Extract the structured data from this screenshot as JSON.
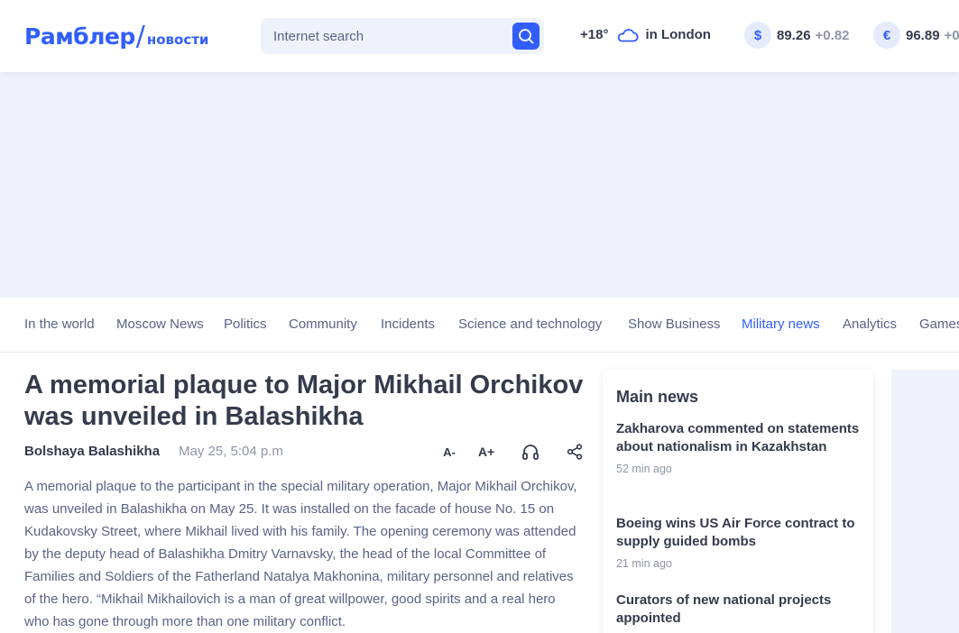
{
  "header": {
    "logo_main": "Рамблер",
    "logo_slash": "/",
    "logo_sub": "новости",
    "search_placeholder": "Internet search",
    "weather": {
      "temp": "+18°",
      "city": "in London"
    },
    "rates": [
      {
        "symbol": "$",
        "value": "89.26",
        "change": "+0.82"
      },
      {
        "symbol": "€",
        "value": "96.89",
        "change": "+0"
      }
    ]
  },
  "nav": {
    "items": [
      {
        "label": "In the world",
        "active": false
      },
      {
        "label": "Moscow News",
        "active": false
      },
      {
        "label": "Politics",
        "active": false
      },
      {
        "label": "Community",
        "active": false
      },
      {
        "label": "Incidents",
        "active": false
      },
      {
        "label": "Science and technology",
        "active": false
      },
      {
        "label": "Show Business",
        "active": false
      },
      {
        "label": "Military news",
        "active": true
      },
      {
        "label": "Analytics",
        "active": false
      },
      {
        "label": "Games",
        "active": false
      }
    ]
  },
  "article": {
    "title": "A memorial plaque to Major Mikhail Orchikov was unveiled in Balashikha",
    "source": "Bolshaya Balashikha",
    "date": "May 25, 5:04 p.m",
    "tools": {
      "font_decrease": "A-",
      "font_increase": "A+"
    },
    "body": "A memorial plaque to the participant in the special military operation, Major Mikhail Orchikov, was unveiled in Balashikha on May 25. It was installed on the facade of house No. 15 on Kudakovsky Street, where Mikhail lived with his family. The opening ceremony was attended by the deputy head of Balashikha Dmitry Varnavsky, the head of the local Committee of Families and Soldiers of the Fatherland Natalya Makhonina, military personnel and relatives of the hero. “Mikhail Mikhailovich is a man of great willpower, good spirits and a real hero who has gone through more than one military conflict."
  },
  "main_news": {
    "title": "Main news",
    "items": [
      {
        "headline": "Zakharova commented on statements about nationalism in Kazakhstan",
        "time": "52 min ago"
      },
      {
        "headline": "Boeing wins US Air Force contract to supply guided bombs",
        "time": "21 min ago"
      },
      {
        "headline": "Curators of new national projects appointed",
        "time": ""
      }
    ]
  },
  "colors": {
    "accent": "#315efb",
    "text": "#343b4c",
    "muted": "#8e95a6",
    "bg_light": "#eef2fb"
  }
}
